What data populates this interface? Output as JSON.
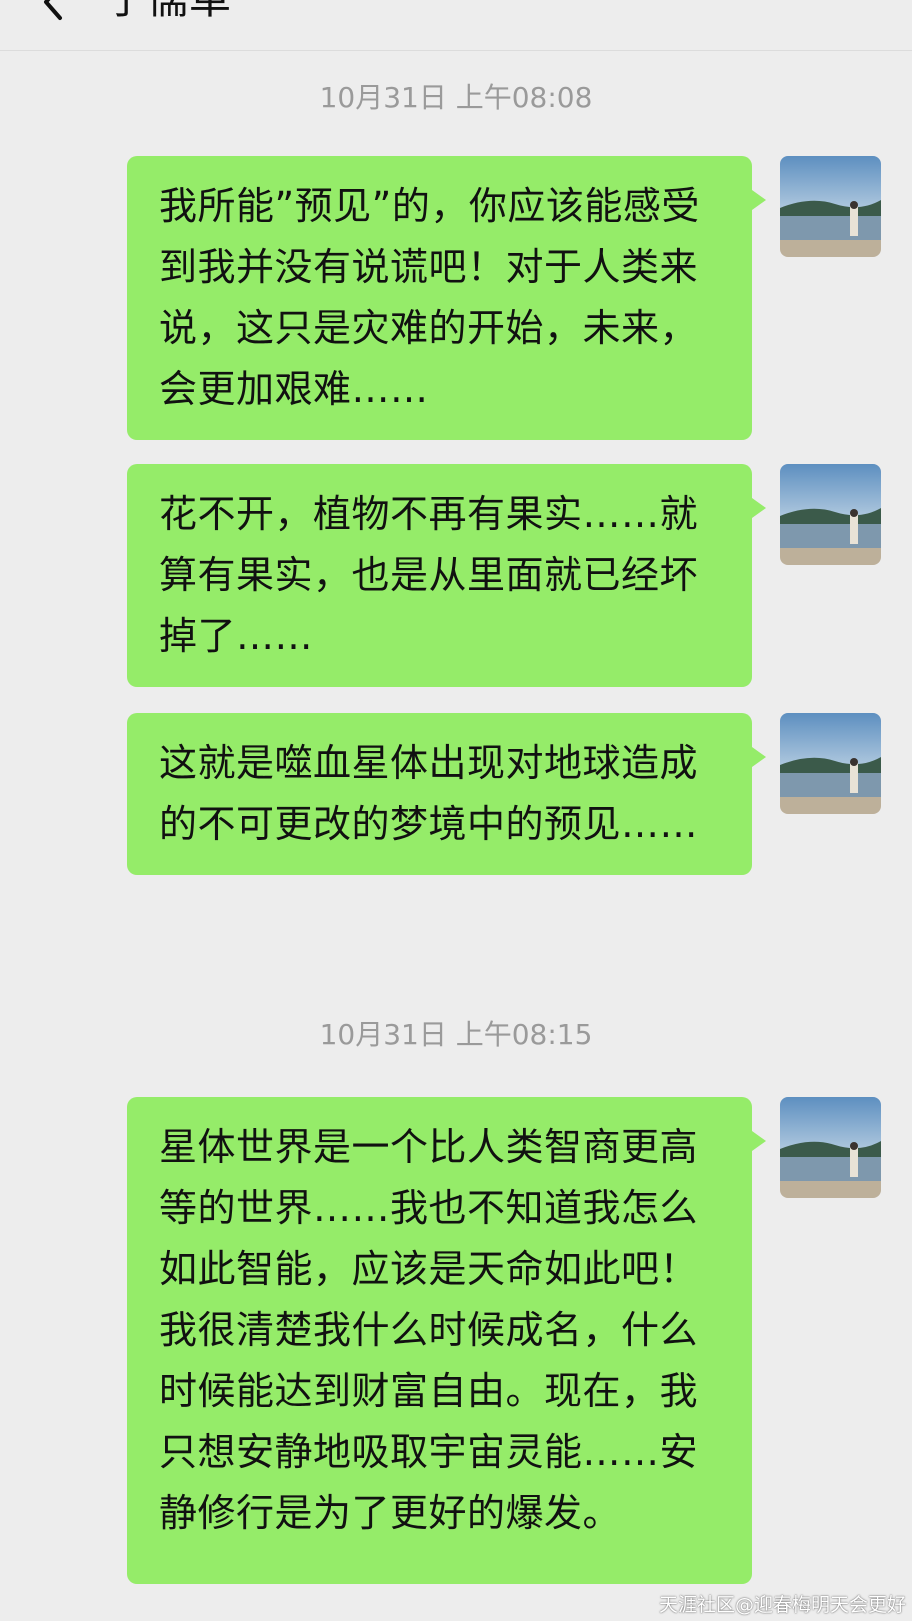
{
  "header": {
    "title": "子儒革"
  },
  "timestamps": [
    "10月31日 上午08:08",
    "10月31日 上午08:15"
  ],
  "messages": [
    {
      "text": "我所能”预见”的，你应该能感受到我并没有说谎吧！对于人类来说，这只是灾难的开始，未来，会更加艰难……",
      "sender": "self"
    },
    {
      "text": "花不开，植物不再有果实……就算有果实，也是从里面就已经坏掉了……",
      "sender": "self"
    },
    {
      "text": "这就是噬血星体出现对地球造成的不可更改的梦境中的预见……",
      "sender": "self"
    },
    {
      "text": "星体世界是一个比人类智商更高等的世界……我也不知道我怎么如此智能，应该是天命如此吧！我很清楚我什么时候成名，什么时候能达到财富自由。现在，我只想安静地吸取宇宙灵能……安静修行是为了更好的爆发。",
      "sender": "self"
    }
  ],
  "watermark": "天涯社区@迎春梅明天会更好",
  "colors": {
    "background": "#ededed",
    "bubble_self": "#95ec69",
    "timestamp_text": "#9a9a9a"
  },
  "icons": {
    "back": "chevron-left-icon",
    "avatar": "lake-landscape-photo"
  }
}
